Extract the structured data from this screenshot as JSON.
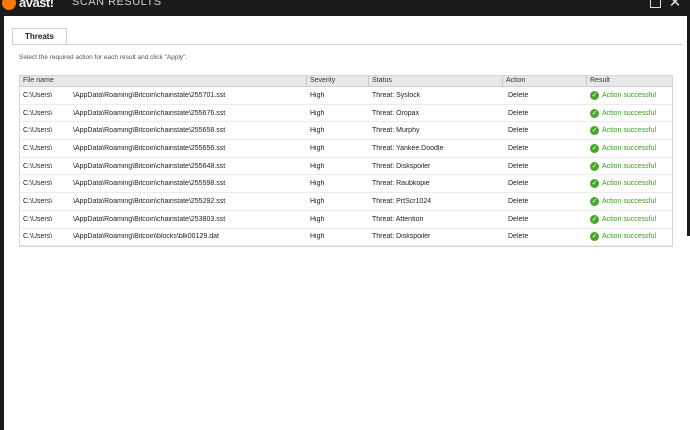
{
  "app": {
    "logo_text": "avast!",
    "window_title": "SCAN RESULTS"
  },
  "tabs": [
    {
      "label": "Threats"
    }
  ],
  "instruction": "Select the required action for each result and click \"Apply\".",
  "table": {
    "columns": [
      "File name",
      "Severity",
      "Status",
      "Action",
      "Result"
    ],
    "rows": [
      {
        "user": "C:\\Users\\",
        "path": "\\AppData\\Roaming\\Bitcoin\\chainstate\\255701.sst",
        "severity": "High",
        "status": "Threat: Syslock",
        "action": "Delete",
        "result": "Action successful"
      },
      {
        "user": "C:\\Users\\",
        "path": "\\AppData\\Roaming\\Bitcoin\\chainstate\\255676.sst",
        "severity": "High",
        "status": "Threat: Oropax",
        "action": "Delete",
        "result": "Action successful"
      },
      {
        "user": "C:\\Users\\",
        "path": "\\AppData\\Roaming\\Bitcoin\\chainstate\\255658.sst",
        "severity": "High",
        "status": "Threat: Murphy",
        "action": "Delete",
        "result": "Action successful"
      },
      {
        "user": "C:\\Users\\",
        "path": "\\AppData\\Roaming\\Bitcoin\\chainstate\\255656.sst",
        "severity": "High",
        "status": "Threat: Yankee Doodle",
        "action": "Delete",
        "result": "Action successful"
      },
      {
        "user": "C:\\Users\\",
        "path": "\\AppData\\Roaming\\Bitcoin\\chainstate\\255648.sst",
        "severity": "High",
        "status": "Threat: Diskspoiler",
        "action": "Delete",
        "result": "Action successful"
      },
      {
        "user": "C:\\Users\\",
        "path": "\\AppData\\Roaming\\Bitcoin\\chainstate\\255598.sst",
        "severity": "High",
        "status": "Threat: Raubkopie",
        "action": "Delete",
        "result": "Action successful"
      },
      {
        "user": "C:\\Users\\",
        "path": "\\AppData\\Roaming\\Bitcoin\\chainstate\\255292.sst",
        "severity": "High",
        "status": "Threat: PrtScr1024",
        "action": "Delete",
        "result": "Action successful"
      },
      {
        "user": "C:\\Users\\",
        "path": "\\AppData\\Roaming\\Bitcoin\\chainstate\\253803.sst",
        "severity": "High",
        "status": "Threat: Attention",
        "action": "Delete",
        "result": "Action successful"
      },
      {
        "user": "C:\\Users\\",
        "path": "\\AppData\\Roaming\\Bitcoin\\blocks\\blk00129.dat",
        "severity": "High",
        "status": "Threat: Diskspoiler",
        "action": "Delete",
        "result": "Action successful"
      }
    ]
  },
  "icons": {
    "maximize": "maximize-icon",
    "close": "close-icon",
    "result": "check-circle-icon"
  },
  "colors": {
    "brand_orange": "#ff7800",
    "titlebar": "#1b1b1b",
    "success_green": "#3c9a1e"
  }
}
